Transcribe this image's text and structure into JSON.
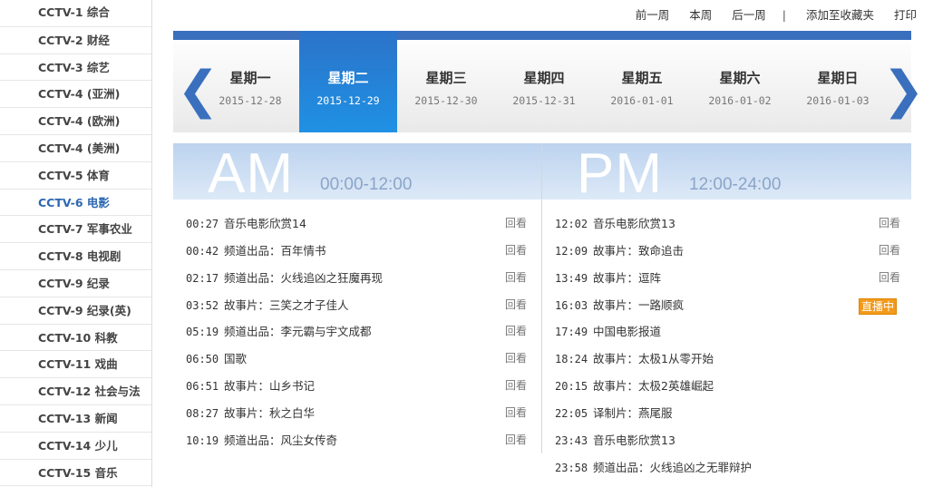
{
  "sidebar": {
    "channels": [
      "CCTV-1 综合",
      "CCTV-2 财经",
      "CCTV-3 综艺",
      "CCTV-4 (亚洲)",
      "CCTV-4 (欧洲)",
      "CCTV-4 (美洲)",
      "CCTV-5 体育",
      "CCTV-6 电影",
      "CCTV-7 军事农业",
      "CCTV-8 电视剧",
      "CCTV-9 纪录",
      "CCTV-9 纪录(英)",
      "CCTV-10 科教",
      "CCTV-11 戏曲",
      "CCTV-12 社会与法",
      "CCTV-13 新闻",
      "CCTV-14 少儿",
      "CCTV-15 音乐"
    ],
    "active_channel": "CCTV-6 电影"
  },
  "toplinks": {
    "prev_week": "前一周",
    "this_week": "本周",
    "next_week": "后一周",
    "separator": "|",
    "bookmark": "添加至收藏夹",
    "print": "打印"
  },
  "week": {
    "left_arrow": "❮",
    "right_arrow": "❯",
    "days": [
      {
        "name": "星期一",
        "date": "2015-12-28"
      },
      {
        "name": "星期二",
        "date": "2015-12-29"
      },
      {
        "name": "星期三",
        "date": "2015-12-30"
      },
      {
        "name": "星期四",
        "date": "2015-12-31"
      },
      {
        "name": "星期五",
        "date": "2016-01-01"
      },
      {
        "name": "星期六",
        "date": "2016-01-02"
      },
      {
        "name": "星期日",
        "date": "2016-01-03"
      }
    ],
    "active_day": "星期二"
  },
  "am": {
    "label": "AM",
    "range": "00:00-12:00",
    "programs": [
      {
        "time": "00:27",
        "title": "音乐电影欣赏14",
        "action": "回看"
      },
      {
        "time": "00:42",
        "title": "频道出品：百年情书",
        "action": "回看"
      },
      {
        "time": "02:17",
        "title": "频道出品：火线追凶之狂魔再现",
        "action": "回看"
      },
      {
        "time": "03:52",
        "title": "故事片：三笑之才子佳人",
        "action": "回看"
      },
      {
        "time": "05:19",
        "title": "频道出品：李元霸与宇文成都",
        "action": "回看"
      },
      {
        "time": "06:50",
        "title": "国歌",
        "action": "回看"
      },
      {
        "time": "06:51",
        "title": "故事片：山乡书记",
        "action": "回看"
      },
      {
        "time": "08:27",
        "title": "故事片：秋之白华",
        "action": "回看"
      },
      {
        "time": "10:19",
        "title": "频道出品：风尘女传奇",
        "action": "回看"
      }
    ]
  },
  "pm": {
    "label": "PM",
    "range": "12:00-24:00",
    "programs": [
      {
        "time": "12:02",
        "title": "音乐电影欣赏13",
        "action": "回看"
      },
      {
        "time": "12:09",
        "title": "故事片：致命追击",
        "action": "回看"
      },
      {
        "time": "13:49",
        "title": "故事片：逗阵",
        "action": "回看"
      },
      {
        "time": "16:03",
        "title": "故事片：一路顺疯",
        "action": "直播中",
        "live": true
      },
      {
        "time": "17:49",
        "title": "中国电影报道",
        "action": ""
      },
      {
        "time": "18:24",
        "title": "故事片：太极1从零开始",
        "action": ""
      },
      {
        "time": "20:15",
        "title": "故事片：太极2英雄崛起",
        "action": ""
      },
      {
        "time": "22:05",
        "title": "译制片：燕尾服",
        "action": ""
      },
      {
        "time": "23:43",
        "title": "音乐电影欣赏13",
        "action": ""
      },
      {
        "time": "23:58",
        "title": "频道出品：火线追凶之无罪辩护",
        "action": ""
      }
    ]
  },
  "colors": {
    "accent": "#3a6fbe",
    "active_day": "#1f91e4",
    "live_badge": "#f29a1b"
  }
}
